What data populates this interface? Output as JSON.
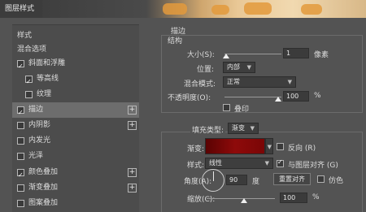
{
  "window": {
    "title": "图层样式"
  },
  "styles_list": [
    {
      "label": "样式",
      "checkbox": false,
      "checked": false,
      "selected": false,
      "plus": false,
      "indent": 0
    },
    {
      "label": "混合选项",
      "checkbox": false,
      "checked": false,
      "selected": false,
      "plus": false,
      "indent": 0
    },
    {
      "label": "斜面和浮雕",
      "checkbox": true,
      "checked": true,
      "selected": false,
      "plus": false,
      "indent": 0
    },
    {
      "label": "等高线",
      "checkbox": true,
      "checked": true,
      "selected": false,
      "plus": false,
      "indent": 1
    },
    {
      "label": "纹理",
      "checkbox": true,
      "checked": false,
      "selected": false,
      "plus": false,
      "indent": 1
    },
    {
      "label": "描边",
      "checkbox": true,
      "checked": true,
      "selected": true,
      "plus": true,
      "indent": 0
    },
    {
      "label": "内阴影",
      "checkbox": true,
      "checked": false,
      "selected": false,
      "plus": true,
      "indent": 0
    },
    {
      "label": "内发光",
      "checkbox": true,
      "checked": false,
      "selected": false,
      "plus": false,
      "indent": 0
    },
    {
      "label": "光泽",
      "checkbox": true,
      "checked": false,
      "selected": false,
      "plus": false,
      "indent": 0
    },
    {
      "label": "颜色叠加",
      "checkbox": true,
      "checked": true,
      "selected": false,
      "plus": true,
      "indent": 0
    },
    {
      "label": "渐变叠加",
      "checkbox": true,
      "checked": false,
      "selected": false,
      "plus": true,
      "indent": 0
    },
    {
      "label": "图案叠加",
      "checkbox": true,
      "checked": false,
      "selected": false,
      "plus": false,
      "indent": 0
    }
  ],
  "stroke": {
    "section_title": "描边",
    "structure_title": "结构",
    "size_label": "大小(S):",
    "size_value": "1",
    "size_unit": "像素",
    "position_label": "位置:",
    "position_value": "内部",
    "blend_label": "混合模式:",
    "blend_value": "正常",
    "opacity_label": "不透明度(O):",
    "opacity_value": "100",
    "opacity_unit": "%",
    "overprint_label": "叠印",
    "fill_type_label": "填充类型:",
    "fill_type_value": "渐变",
    "gradient_label": "渐变:",
    "gradient_colors": [
      "#5a0303",
      "#8e0a0a",
      "#7a0606"
    ],
    "reverse_label": "反向 (R)",
    "style_label": "样式:",
    "style_value": "线性",
    "align_label": "与图层对齐 (G)",
    "angle_label": "角度(A):",
    "angle_value": "90",
    "angle_unit": "度",
    "reset_align_label": "重置对齐",
    "dither_label": "仿色",
    "scale_label": "缩放(C):",
    "scale_value": "100",
    "scale_unit": "%"
  },
  "colors": {
    "panel_bg": "#535353",
    "list_bg": "#4c4c4c",
    "selected_bg": "#6d6d6d"
  },
  "icons": {
    "dropdown": "chevron-down-icon",
    "add": "plus-icon",
    "check": "checkmark-icon"
  }
}
